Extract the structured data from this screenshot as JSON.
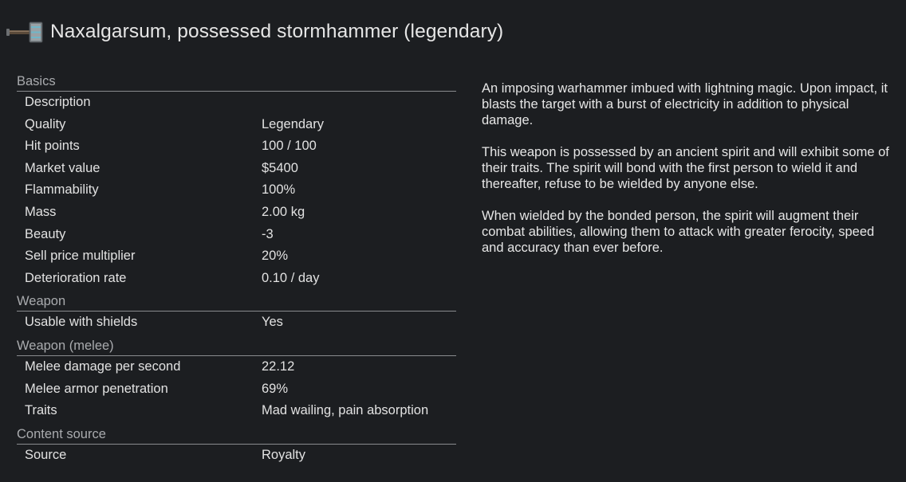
{
  "header": {
    "title": "Naxalgarsum, possessed stormhammer (legendary)",
    "icon": "stormhammer-icon"
  },
  "sections": [
    {
      "title": "Basics",
      "rows": [
        {
          "label": "Description",
          "value": ""
        },
        {
          "label": "Quality",
          "value": "Legendary"
        },
        {
          "label": "Hit points",
          "value": "100 / 100"
        },
        {
          "label": "Market value",
          "value": "$5400"
        },
        {
          "label": "Flammability",
          "value": "100%"
        },
        {
          "label": "Mass",
          "value": "2.00 kg"
        },
        {
          "label": "Beauty",
          "value": "-3"
        },
        {
          "label": "Sell price multiplier",
          "value": "20%"
        },
        {
          "label": "Deterioration rate",
          "value": "0.10 / day"
        }
      ]
    },
    {
      "title": "Weapon",
      "rows": [
        {
          "label": "Usable with shields",
          "value": "Yes"
        }
      ]
    },
    {
      "title": "Weapon (melee)",
      "rows": [
        {
          "label": "Melee damage per second",
          "value": "22.12"
        },
        {
          "label": "Melee armor penetration",
          "value": "69%"
        },
        {
          "label": "Traits",
          "value": "Mad wailing, pain absorption"
        }
      ]
    },
    {
      "title": "Content source",
      "rows": [
        {
          "label": "Source",
          "value": "Royalty"
        }
      ]
    }
  ],
  "description": {
    "paragraphs": [
      "An imposing warhammer imbued with lightning magic. Upon impact, it blasts the target with a burst of electricity in addition to physical damage.",
      "This weapon is possessed by an ancient spirit and will exhibit some of their traits. The spirit will bond with the first person to wield it and thereafter, refuse to be wielded by anyone else.",
      "When wielded by the bonded person, the spirit will augment their combat abilities, allowing them to attack with greater ferocity, speed and accuracy than ever before."
    ]
  },
  "colors": {
    "background": "#1c1e21",
    "text": "#e2e2e2",
    "section_header": "#a9abae",
    "divider": "#8a8c8f"
  }
}
